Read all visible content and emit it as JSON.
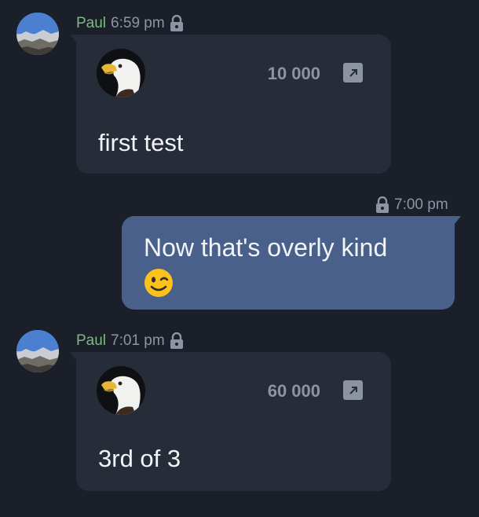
{
  "colors": {
    "background": "#1a1f29",
    "incoming_bubble": "#262d38",
    "outgoing_bubble": "#48608a",
    "sender_name": "#7dba7f",
    "meta_text": "#8d95a3"
  },
  "messages": [
    {
      "direction": "incoming",
      "sender": "Paul",
      "time": "6:59 pm",
      "amount": "10 000",
      "text": "first test",
      "icons": [
        "sender-avatar",
        "lock-icon",
        "eagle-avatar",
        "external-link-icon"
      ]
    },
    {
      "direction": "outgoing",
      "time": "7:00 pm",
      "text": "Now that's overly kind",
      "emoji": "winking-face-emoji",
      "icons": [
        "lock-icon"
      ]
    },
    {
      "direction": "incoming",
      "sender": "Paul",
      "time": "7:01 pm",
      "amount": "60 000",
      "text": "3rd of 3",
      "icons": [
        "sender-avatar",
        "lock-icon",
        "eagle-avatar",
        "external-link-icon"
      ]
    }
  ]
}
